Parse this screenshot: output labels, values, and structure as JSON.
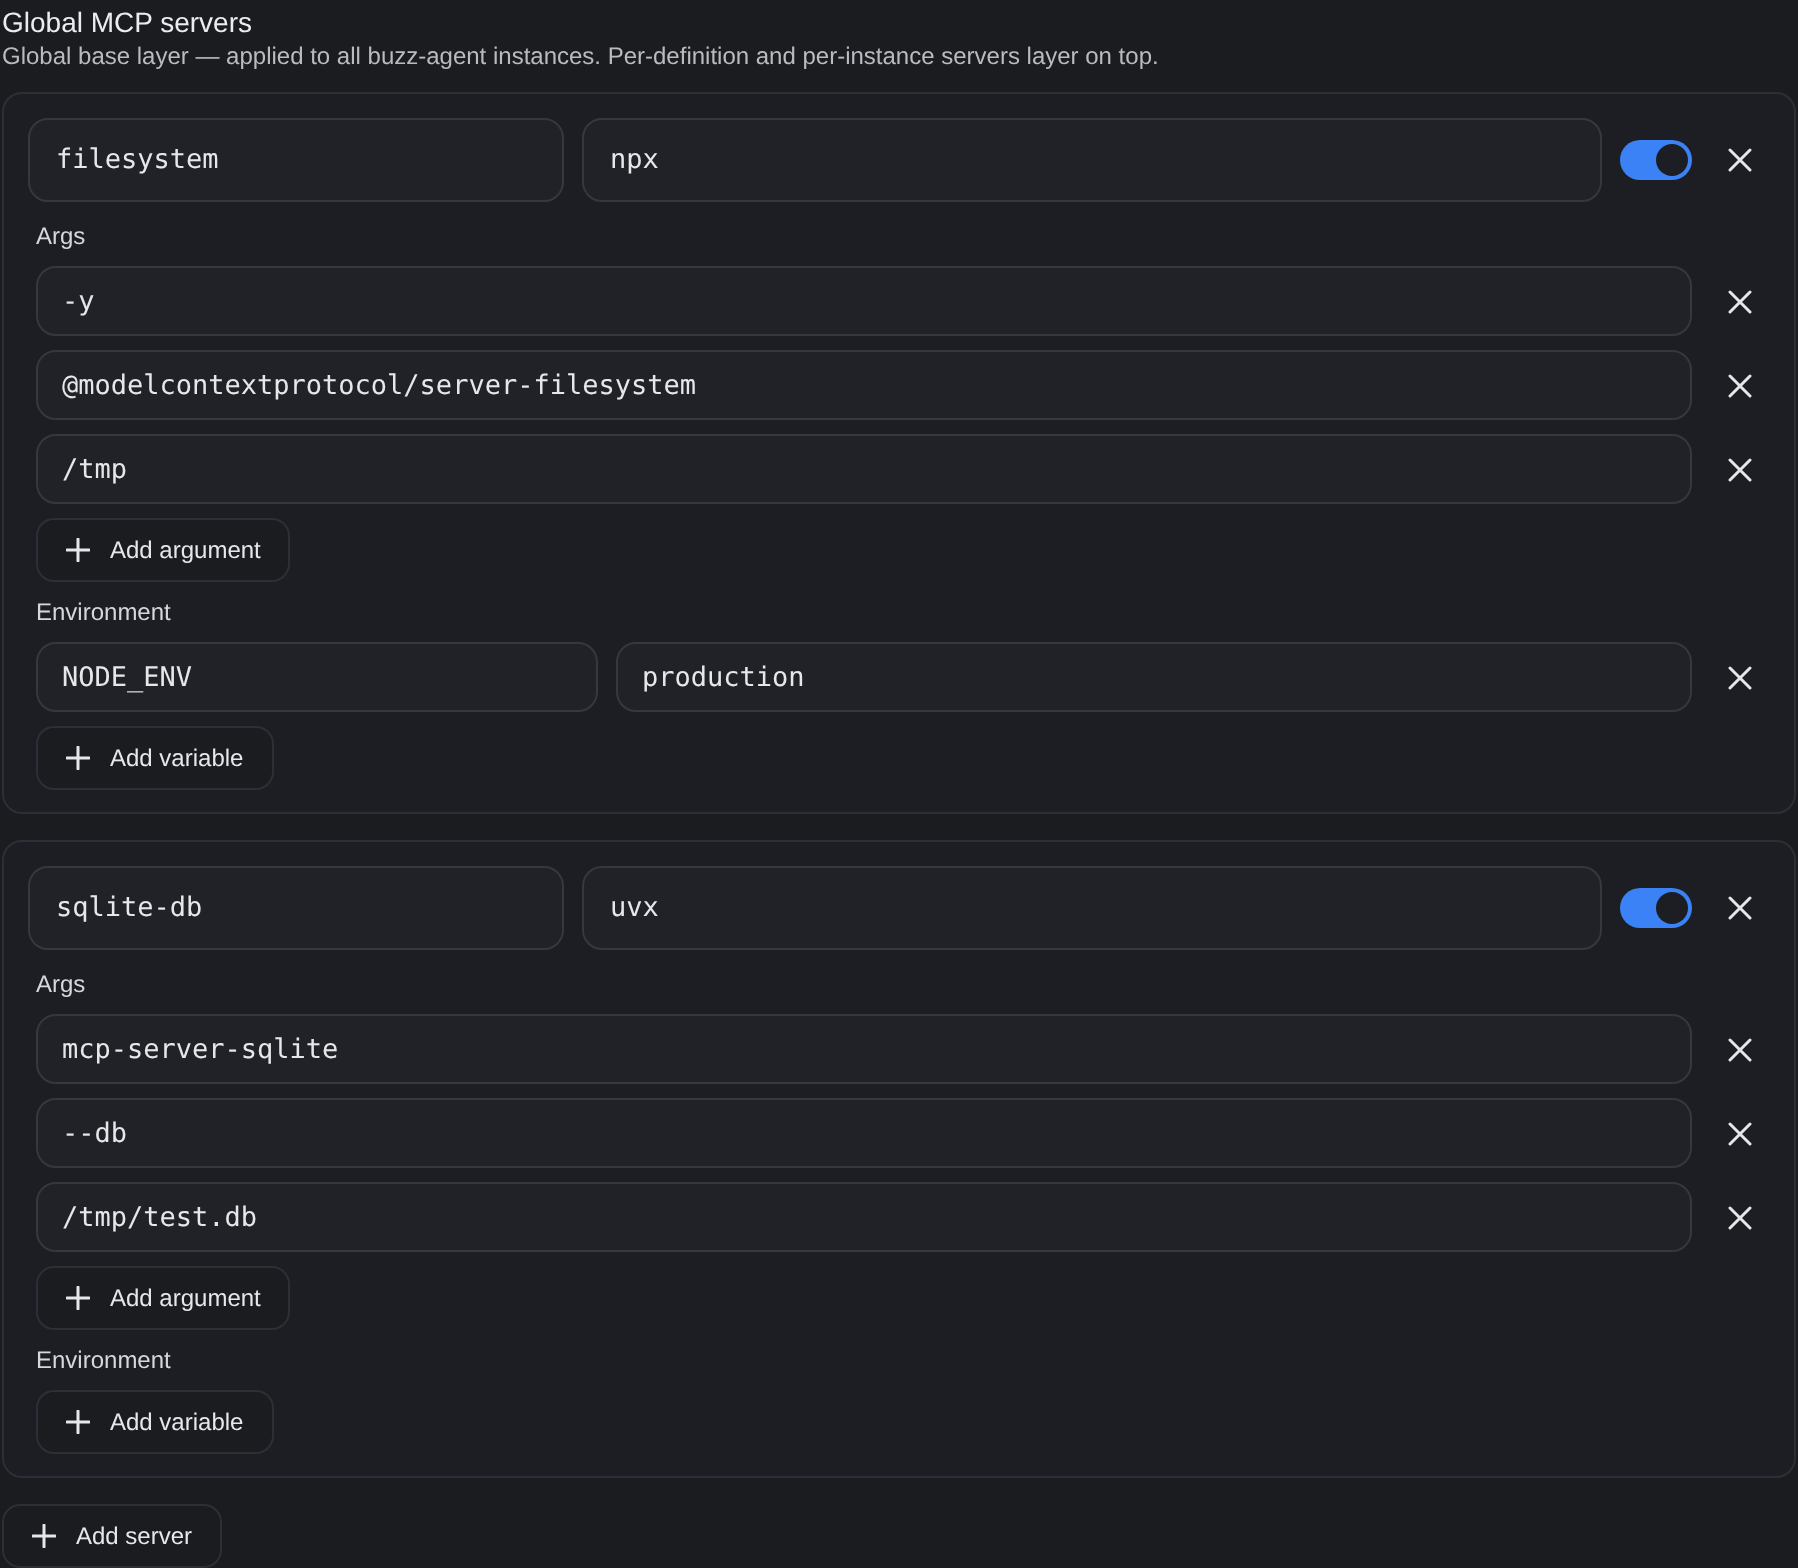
{
  "title": "Global MCP servers",
  "description": "Global base layer — applied to all buzz-agent instances. Per-definition and per-instance servers layer on top.",
  "servers": [
    {
      "name": "filesystem",
      "command": "npx",
      "enabled": true,
      "args_label": "Args",
      "args": [
        "-y",
        "@modelcontextprotocol/server-filesystem",
        "/tmp"
      ],
      "add_argument": "Add argument",
      "env_label": "Environment",
      "env": [
        {
          "key": "NODE_ENV",
          "value": "production"
        }
      ],
      "add_variable": "Add variable"
    },
    {
      "name": "sqlite-db",
      "command": "uvx",
      "enabled": true,
      "args_label": "Args",
      "args": [
        "mcp-server-sqlite",
        "--db",
        "/tmp/test.db"
      ],
      "add_argument": "Add argument",
      "env_label": "Environment",
      "add_variable": "Add variable"
    }
  ],
  "add_server": "Add server"
}
